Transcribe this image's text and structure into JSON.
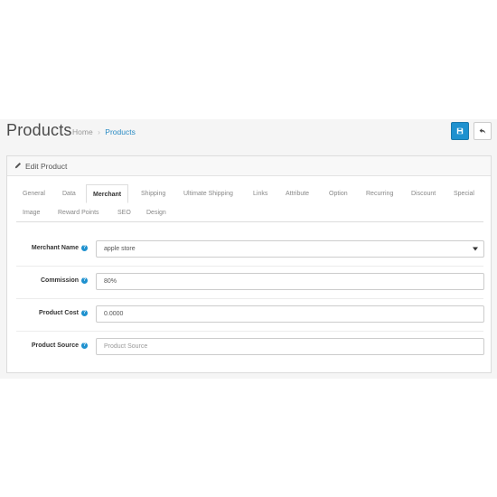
{
  "header": {
    "title": "Products",
    "breadcrumb": [
      {
        "label": "Home"
      },
      {
        "label": "Products"
      }
    ],
    "breadcrumb_separator": "›"
  },
  "panel": {
    "title": "Edit Product"
  },
  "tabs": {
    "row1": [
      "General",
      "Data",
      "Merchant",
      "Shipping",
      "Ultimate Shipping",
      "Links",
      "Attribute",
      "Option",
      "Recurring",
      "Discount",
      "Special"
    ],
    "row2": [
      "Image",
      "Reward Points",
      "SEO",
      "Design"
    ],
    "active": "Merchant"
  },
  "form": {
    "merchant_name": {
      "label": "Merchant Name",
      "value": "apple store"
    },
    "commission": {
      "label": "Commission",
      "value": "80%"
    },
    "product_cost": {
      "label": "Product Cost",
      "value": "0.0000"
    },
    "product_source": {
      "label": "Product Source",
      "value": "",
      "placeholder": "Product Source"
    }
  },
  "colors": {
    "primary": "#1e91cf",
    "link": "#2a8bc4"
  },
  "icons": {
    "save": "save-icon",
    "back": "reply-icon",
    "edit": "pencil-icon",
    "help": "question-circle-icon",
    "select_caret": "caret-down-icon"
  }
}
